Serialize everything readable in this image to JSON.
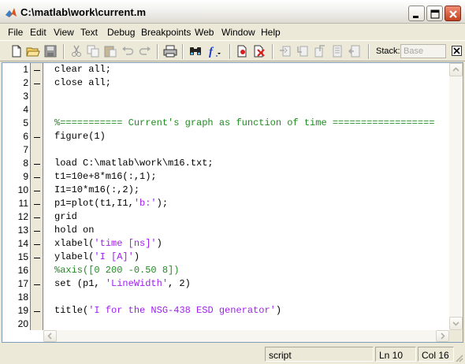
{
  "window": {
    "title": "C:\\matlab\\work\\current.m",
    "app_icon": "matlab-logo-icon",
    "controls": [
      "minimize-icon",
      "maximize-icon",
      "close-icon"
    ]
  },
  "menu": {
    "items": [
      {
        "label": "File"
      },
      {
        "label": "Edit"
      },
      {
        "label": "View"
      },
      {
        "label": "Text"
      },
      {
        "label": "Debug"
      },
      {
        "label": "Breakpoints"
      },
      {
        "label": "Web"
      },
      {
        "label": "Window"
      },
      {
        "label": "Help"
      }
    ]
  },
  "toolbar": {
    "icons": [
      "new-file-icon",
      "open-folder-icon",
      "save-icon",
      "cut-icon",
      "copy-icon",
      "paste-icon",
      "undo-icon",
      "redo-icon",
      "print-icon",
      "find-icon",
      "function-icon",
      "set-breakpoint-icon",
      "clear-breakpoints-icon",
      "step-icon",
      "step-in-icon",
      "step-out-icon",
      "continue-icon",
      "exit-debug-icon"
    ],
    "stack_label": "Stack:",
    "stack_value": "Base"
  },
  "editor": {
    "lines": [
      {
        "num": "1",
        "text": "clear all;",
        "kind": "code",
        "dash": true
      },
      {
        "num": "2",
        "text": "close all;",
        "kind": "code",
        "dash": true
      },
      {
        "num": "3",
        "text": "",
        "kind": "code",
        "dash": false
      },
      {
        "num": "4",
        "text": "",
        "kind": "code",
        "dash": false
      },
      {
        "num": "5",
        "text": "%=========== Current's graph as function of time ==================",
        "kind": "comment",
        "dash": false
      },
      {
        "num": "6",
        "text": "figure(1)",
        "kind": "code",
        "dash": true
      },
      {
        "num": "7",
        "text": "",
        "kind": "code",
        "dash": false
      },
      {
        "num": "8",
        "text": "load C:\\matlab\\work\\m16.txt;",
        "kind": "code",
        "dash": true
      },
      {
        "num": "9",
        "text": "t1=10e+8*m16(:,1);",
        "kind": "code",
        "dash": true
      },
      {
        "num": "10",
        "text": "I1=10*m16(:,2);",
        "kind": "code",
        "dash": true
      },
      {
        "num": "11",
        "text": "p1=plot(t1,I1,'b:');",
        "kind": "mixed",
        "dash": true,
        "parts": [
          [
            "p1=plot(t1,I1,",
            "code"
          ],
          [
            "'b:'",
            "str"
          ],
          [
            ");",
            "code"
          ]
        ]
      },
      {
        "num": "12",
        "text": "grid",
        "kind": "code",
        "dash": true
      },
      {
        "num": "13",
        "text": "hold on",
        "kind": "code",
        "dash": true
      },
      {
        "num": "14",
        "text": "xlabel('time [ns]')",
        "kind": "mixed",
        "dash": true,
        "parts": [
          [
            "xlabel(",
            "code"
          ],
          [
            "'time [ns]'",
            "str"
          ],
          [
            ")",
            "code"
          ]
        ]
      },
      {
        "num": "15",
        "text": "ylabel('I [A]')",
        "kind": "mixed",
        "dash": true,
        "parts": [
          [
            "ylabel(",
            "code"
          ],
          [
            "'I [A]'",
            "str"
          ],
          [
            ")",
            "code"
          ]
        ]
      },
      {
        "num": "16",
        "text": "%axis([0 200 -0.50 8])",
        "kind": "comment",
        "dash": false
      },
      {
        "num": "17",
        "text": "set (p1, 'LineWidth', 2)",
        "kind": "mixed",
        "dash": true,
        "parts": [
          [
            "set (p1, ",
            "code"
          ],
          [
            "'LineWidth'",
            "str"
          ],
          [
            ", 2)",
            "code"
          ]
        ]
      },
      {
        "num": "18",
        "text": "",
        "kind": "code",
        "dash": false
      },
      {
        "num": "19",
        "text": "title('I for the NSG-438 ESD generator')",
        "kind": "mixed",
        "dash": true,
        "parts": [
          [
            "title(",
            "code"
          ],
          [
            "'I for the NSG-438 ESD generator'",
            "str"
          ],
          [
            ")",
            "code"
          ]
        ]
      },
      {
        "num": "20",
        "text": "",
        "kind": "code",
        "dash": false
      }
    ]
  },
  "status": {
    "mode": "script",
    "line": "Ln 10",
    "col": "Col 16"
  }
}
